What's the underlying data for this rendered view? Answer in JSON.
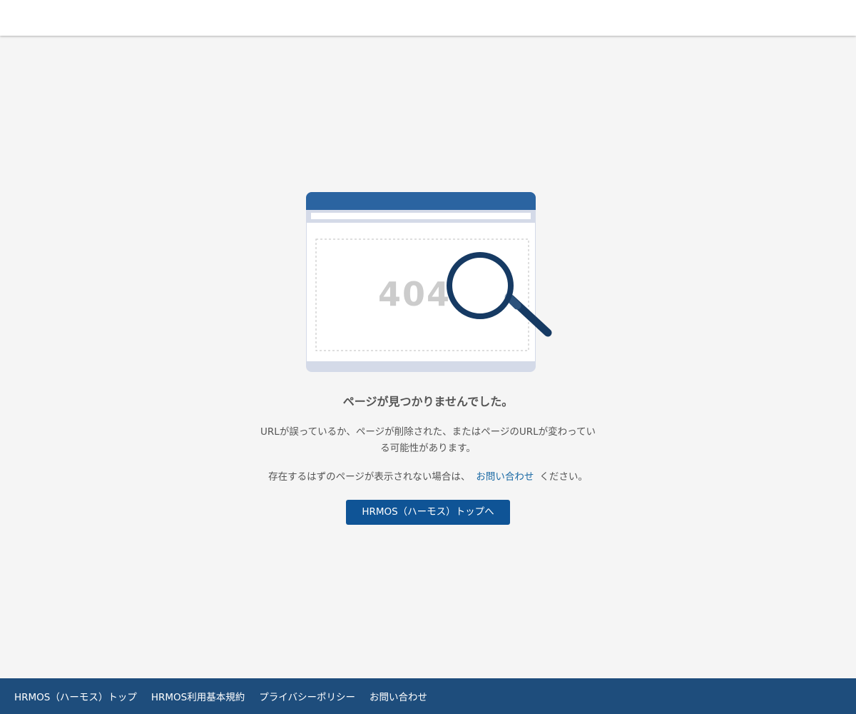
{
  "illustration": {
    "error_code": "404",
    "colors": {
      "titlebar": "#2b64a1",
      "frame": "#d4dae8",
      "magnifier": "#163a63",
      "code_text": "#cccccc"
    }
  },
  "main": {
    "heading": "ページが見つかりませんでした。",
    "description": "URLが誤っているか、ページが削除された、またはページのURLが変わっている可能性があります。",
    "contact_prefix": "存在するはずのページが表示されない場合は、",
    "contact_link": "お問い合わせ",
    "contact_suffix": "ください。",
    "top_button_label": "HRMOS（ハーモス）トップへ"
  },
  "footer": {
    "links": [
      "HRMOS（ハーモス）トップ",
      "HRMOS利用基本規約",
      "プライバシーポリシー",
      "お問い合わせ"
    ]
  },
  "colors": {
    "background": "#f5f5f5",
    "button": "#0f5496",
    "footer": "#1e4d7c",
    "link": "#1b6aa5"
  }
}
